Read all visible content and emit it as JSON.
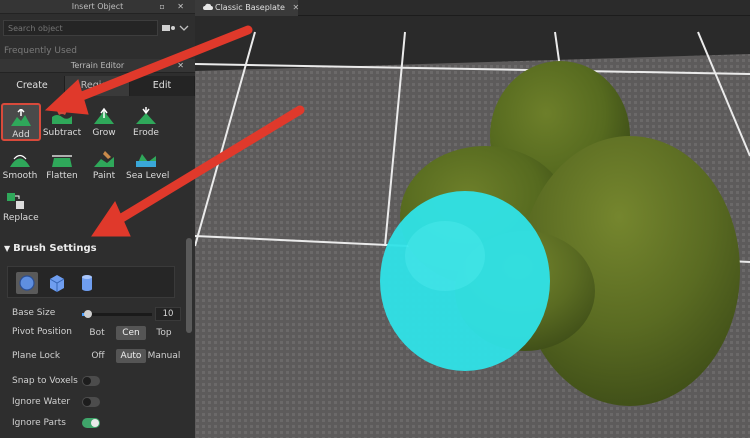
{
  "insert_object": {
    "title": "Insert Object",
    "search_placeholder": "Search object",
    "frequently_used": "Frequently Used"
  },
  "terrain_editor": {
    "title": "Terrain Editor",
    "tabs": [
      {
        "label": "Create"
      },
      {
        "label": "Region"
      },
      {
        "label": "Edit"
      }
    ],
    "tools": [
      {
        "label": "Add"
      },
      {
        "label": "Subtract"
      },
      {
        "label": "Grow"
      },
      {
        "label": "Erode"
      },
      {
        "label": "Smooth"
      },
      {
        "label": "Flatten"
      },
      {
        "label": "Paint"
      },
      {
        "label": "Sea Level"
      },
      {
        "label": "Replace"
      }
    ],
    "selected_tool": "Add"
  },
  "brush_settings": {
    "header": "Brush Settings",
    "shapes": [
      "sphere",
      "cube",
      "cylinder"
    ],
    "selected_shape": "sphere",
    "base_size_label": "Base Size",
    "base_size_value": "10",
    "base_size_fraction": 0.08,
    "pivot_label": "Pivot Position",
    "pivot_options": [
      "Bot",
      "Cen",
      "Top"
    ],
    "pivot_selected": "Cen",
    "plane_lock_label": "Plane Lock",
    "plane_lock_options": [
      "Off",
      "Auto",
      "Manual"
    ],
    "plane_lock_selected": "Auto",
    "snap_to_voxels_label": "Snap to Voxels",
    "snap_to_voxels": false,
    "ignore_water_label": "Ignore Water",
    "ignore_water": false,
    "ignore_parts_label": "Ignore Parts",
    "ignore_parts": true
  },
  "viewport": {
    "tab_title": "Classic Baseplate"
  },
  "colors": {
    "selected_tool_border": "#d84a3b",
    "toggle_on": "#3fa56a",
    "brush_preview": "#2fe3e8",
    "terrain_grass": "#5a6b22",
    "annotation_arrow": "#e0392b"
  }
}
